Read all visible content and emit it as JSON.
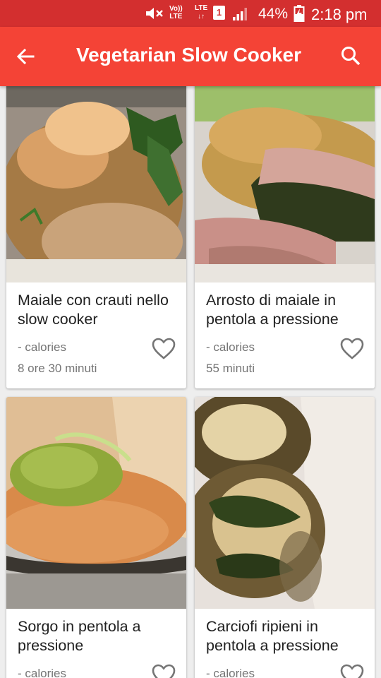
{
  "status_bar": {
    "volte_line1": "Vo))",
    "volte_line2": "LTE",
    "lte_top": "LTE",
    "lte_bottom": "↓↑",
    "sim_slot": "1",
    "battery_percent": "44%",
    "time": "2:18 pm"
  },
  "app_bar": {
    "title": "Vegetarian Slow Cooker",
    "back_icon": "arrow-back-icon",
    "search_icon": "search-icon"
  },
  "recipes": [
    {
      "name": "Maiale con crauti nello slow cooker",
      "calories": "- calories",
      "time": "8 ore 30 minuti"
    },
    {
      "name": "Arrosto di maiale in pentola a pressione",
      "calories": "- calories",
      "time": "55 minuti"
    },
    {
      "name": "Sorgo in pentola a pressione",
      "calories": "- calories",
      "time": ""
    },
    {
      "name": "Carciofi ripieni in pentola a pressione",
      "calories": "- calories",
      "time": ""
    }
  ],
  "colors": {
    "status_bar": "#d32f2f",
    "app_bar": "#f44336",
    "background": "#eeeeee"
  }
}
